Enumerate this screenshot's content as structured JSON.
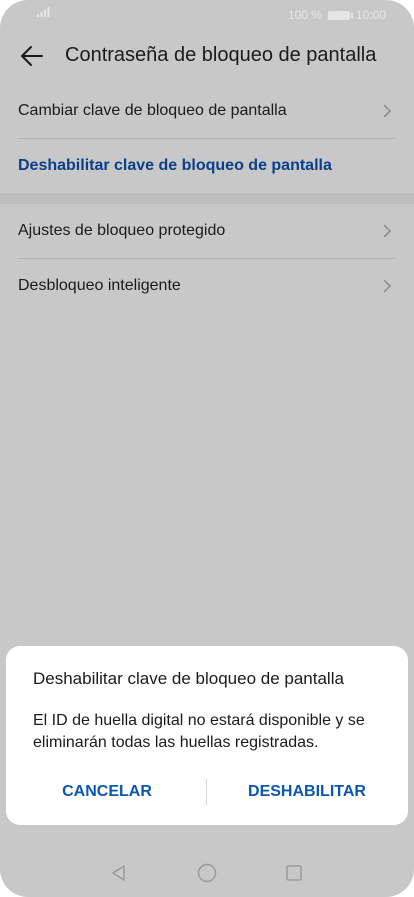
{
  "status_bar": {
    "battery_percent": "100 %",
    "time": "10:00"
  },
  "header": {
    "title": "Contraseña de bloqueo de pantalla"
  },
  "settings": {
    "group1": [
      {
        "label": "Cambiar clave de bloqueo de pantalla"
      },
      {
        "label": "Deshabilitar clave de bloqueo de pantalla"
      }
    ],
    "group2": [
      {
        "label": "Ajustes de bloqueo protegido"
      },
      {
        "label": "Desbloqueo inteligente"
      }
    ]
  },
  "dialog": {
    "title": "Deshabilitar clave de bloqueo de pantalla",
    "body": "El ID de huella digital no estará disponible y se eliminarán todas las huellas registradas.",
    "cancel_label": "CANCELAR",
    "confirm_label": "DESHABILITAR"
  },
  "colors": {
    "accent": "#0b3f8a",
    "dialog_button": "#0b57b0",
    "scrim_background": "#c8c8c8"
  },
  "icons": {
    "back": "arrow-left-icon",
    "chevron": "chevron-right-icon",
    "nav_back": "triangle-back-icon",
    "nav_home": "circle-home-icon",
    "nav_recent": "square-recent-icon"
  }
}
